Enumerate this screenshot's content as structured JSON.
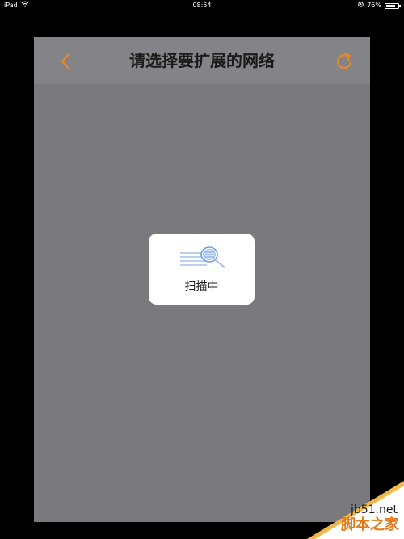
{
  "status_bar": {
    "device": "iPad",
    "time": "08:54",
    "battery": "76%",
    "battery_level": 0.76
  },
  "navbar": {
    "title": "请选择要扩展的网络",
    "back_icon": "chevron-left-icon",
    "refresh_icon": "refresh-icon"
  },
  "hud": {
    "label": "扫描中",
    "icon": "scanning-magnifier-icon"
  },
  "watermark": {
    "site": "jb51.net",
    "brand": "脚本之家"
  },
  "colors": {
    "accent": "#e0882a",
    "overlay": "#7a797d",
    "navbar": "#848387"
  }
}
